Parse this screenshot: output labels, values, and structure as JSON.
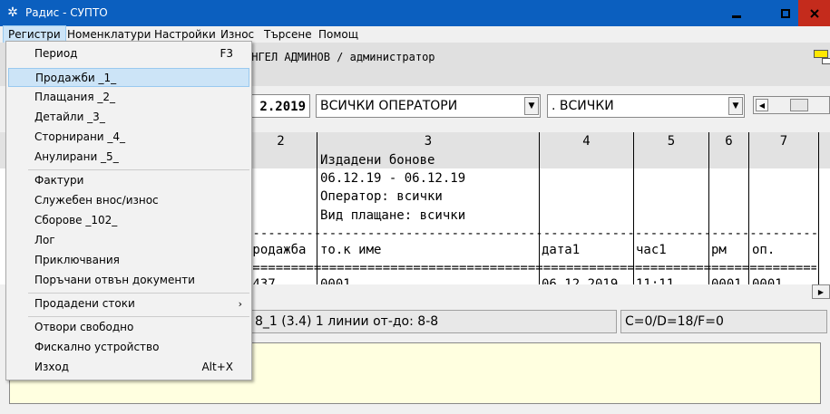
{
  "window": {
    "title": "Радис - СУПТО",
    "app_icon": "compass-icon"
  },
  "menubar": {
    "items": [
      {
        "label": "Регистри"
      },
      {
        "label": "Номенклатури"
      },
      {
        "label": "Настройки"
      },
      {
        "label": "Износ"
      },
      {
        "label": "Търсене"
      },
      {
        "label": "Помощ"
      }
    ]
  },
  "header": {
    "user_line": "АНГЕЛ АДМИНОВ / администратор",
    "date_value": "2.2019",
    "operator_combo": "ВСИЧКИ ОПЕРАТОРИ",
    "filter_combo": ".  ВСИЧКИ"
  },
  "grid": {
    "column_numbers": [
      "2",
      "3",
      "4",
      "5",
      "6",
      "7"
    ],
    "report_lines": [
      "Издадени бонове",
      "06.12.19 - 06.12.19",
      "Оператор: всички",
      "Вид плащане: всички"
    ],
    "dashes": "-------------------------------------------------------------------------------------",
    "col_headers": [
      "продажба",
      "то.к име",
      "дата1",
      "час1",
      "рм",
      "оп."
    ],
    "equals": "=====================================================================================",
    "partial_row": [
      "0437",
      "0001",
      "06.12.2019",
      "11:11",
      "0001",
      "0001"
    ]
  },
  "status": {
    "left": "8_1 (3.4) 1 линии от-до: 8-8",
    "right": "C=0/D=18/F=0"
  },
  "dropdown": {
    "items": [
      {
        "label": "Период",
        "shortcut": "F3"
      },
      {
        "label": "Продажби _1_"
      },
      {
        "label": "Плащания _2_"
      },
      {
        "label": "Детайли _3_"
      },
      {
        "label": "Сторнирани _4_"
      },
      {
        "label": "Анулирани _5_"
      },
      {
        "label": "Фактури"
      },
      {
        "label": "Служебен внос/износ"
      },
      {
        "label": "Сборове _102_"
      },
      {
        "label": "Лог"
      },
      {
        "label": "Приключвания"
      },
      {
        "label": "Поръчани отвън документи"
      },
      {
        "label": "Продадени стоки",
        "submenu": "›"
      },
      {
        "label": "Отвори свободно"
      },
      {
        "label": "Фискално устройство"
      },
      {
        "label": "Изход",
        "shortcut": "Alt+X"
      }
    ]
  }
}
